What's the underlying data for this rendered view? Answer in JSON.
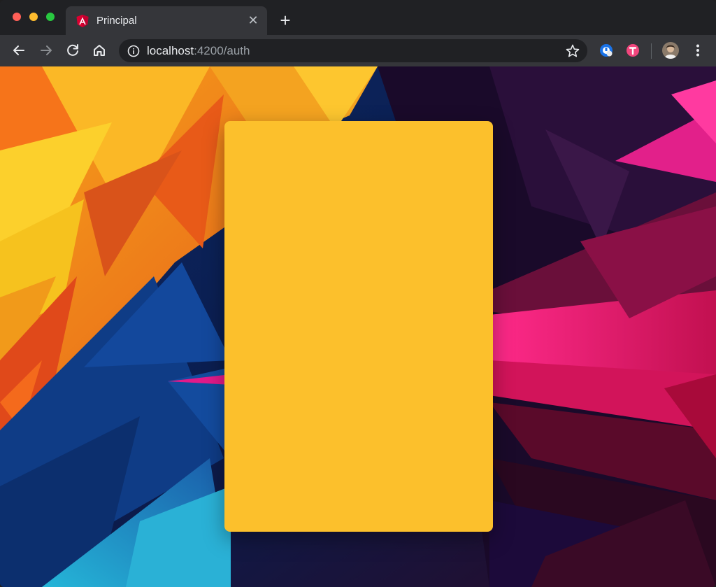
{
  "browser": {
    "tab": {
      "title": "Principal",
      "favicon_icon": "angular-logo-icon"
    },
    "address_bar": {
      "host": "localhost",
      "path": ":4200/auth"
    },
    "colors": {
      "tab_active": "#35363a",
      "tab_strip": "#202124",
      "omnibox": "#202124"
    }
  },
  "page": {
    "card": {
      "color": "#fcc02c"
    }
  }
}
